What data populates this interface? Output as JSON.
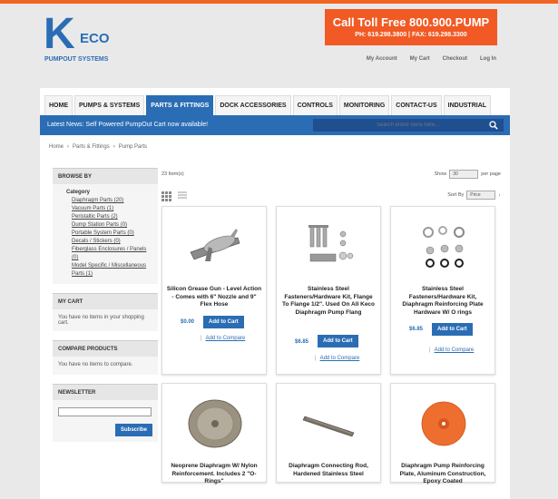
{
  "header": {
    "logo_letter": "K",
    "logo_text": "ECO",
    "logo_sub": "PUMPOUT SYSTEMS",
    "call_title": "Call Toll Free 800.900.PUMP",
    "call_phone": "PH: 619.298.3800  |  FAX: 619.298.3300",
    "links": [
      "My Account",
      "My Cart",
      "Checkout",
      "Log In"
    ]
  },
  "nav": {
    "tabs": [
      "HOME",
      "PUMPS & SYSTEMS",
      "PARTS & FITTINGS",
      "DOCK ACCESSORIES",
      "CONTROLS",
      "MONITORING",
      "CONTACT-US",
      "INDUSTRIAL"
    ],
    "active": "PARTS & FITTINGS"
  },
  "news": {
    "text": "Latest News: Self Powered PumpOut Cart now available!",
    "search_placeholder": "Search entire store here..."
  },
  "breadcrumb": [
    "Home",
    "›",
    "Parts & Fittings",
    "›",
    "Pump Parts"
  ],
  "sidebar": {
    "browse_title": "BROWSE BY",
    "category_label": "Category",
    "categories": [
      "Diaphragm Parts (20)",
      "Vacuum Parts (1)",
      "Peristaltic Parts (2)",
      "Dump Station Parts (0)",
      "Portable System Parts (0)",
      "Decals / Stickers (0)",
      "Fiberglass Enclosures / Panels (0)",
      "Model Specific / Miscellaneous Parts (1)"
    ],
    "cart_title": "MY CART",
    "cart_text": "You have no items in your shopping cart.",
    "compare_title": "COMPARE PRODUCTS",
    "compare_text": "You have no items to compare.",
    "newsletter_title": "NEWSLETTER",
    "subscribe_label": "Subscribe"
  },
  "toolbar": {
    "count": "23 Item(s)",
    "show_label": "Show",
    "show_value": "30",
    "per_page": "per page",
    "sort_label": "Sort By",
    "sort_value": "Price",
    "sort_dir": "↓"
  },
  "products": [
    {
      "name": "Silicon Grease Gun - Level Action - Comes with 6\" Nozzle and 9\" Flex Hose",
      "price": "$0.00",
      "cart": "Add to Cart",
      "compare": "Add to Compare",
      "icon": "grease-gun-image"
    },
    {
      "name": "Stainless Steel Fasteners/Hardware Kit, Flange To Flange 1/2\". Used On All Keco Diaphragm Pump Flang",
      "price": "$6.85",
      "cart": "Add to Cart",
      "compare": "Add to Compare",
      "icon": "bolts-image"
    },
    {
      "name": "Stainless Steel Fasteners/Hardware Kit, Diaphragm Reinforcing Plate Hardware W/ O rings",
      "price": "$6.85",
      "cart": "Add to Cart",
      "compare": "Add to Compare",
      "icon": "washers-image"
    },
    {
      "name": "Neoprene Diaphragm W/ Nylon Reinforcement. Includes 2 \"O-Rings\"",
      "price": "",
      "cart": "",
      "compare": "",
      "icon": "diaphragm-image"
    },
    {
      "name": "Diaphragm Connecting Rod, Hardened Stainless Steel",
      "price": "",
      "cart": "",
      "compare": "",
      "icon": "rod-image"
    },
    {
      "name": "Diaphragm Pump Reinforcing Plate, Aluminum Construction, Epoxy Coated",
      "price": "",
      "cart": "",
      "compare": "",
      "icon": "orange-plate-image"
    }
  ],
  "colors": {
    "brand_blue": "#2b6db4",
    "accent_orange": "#f15a24"
  }
}
